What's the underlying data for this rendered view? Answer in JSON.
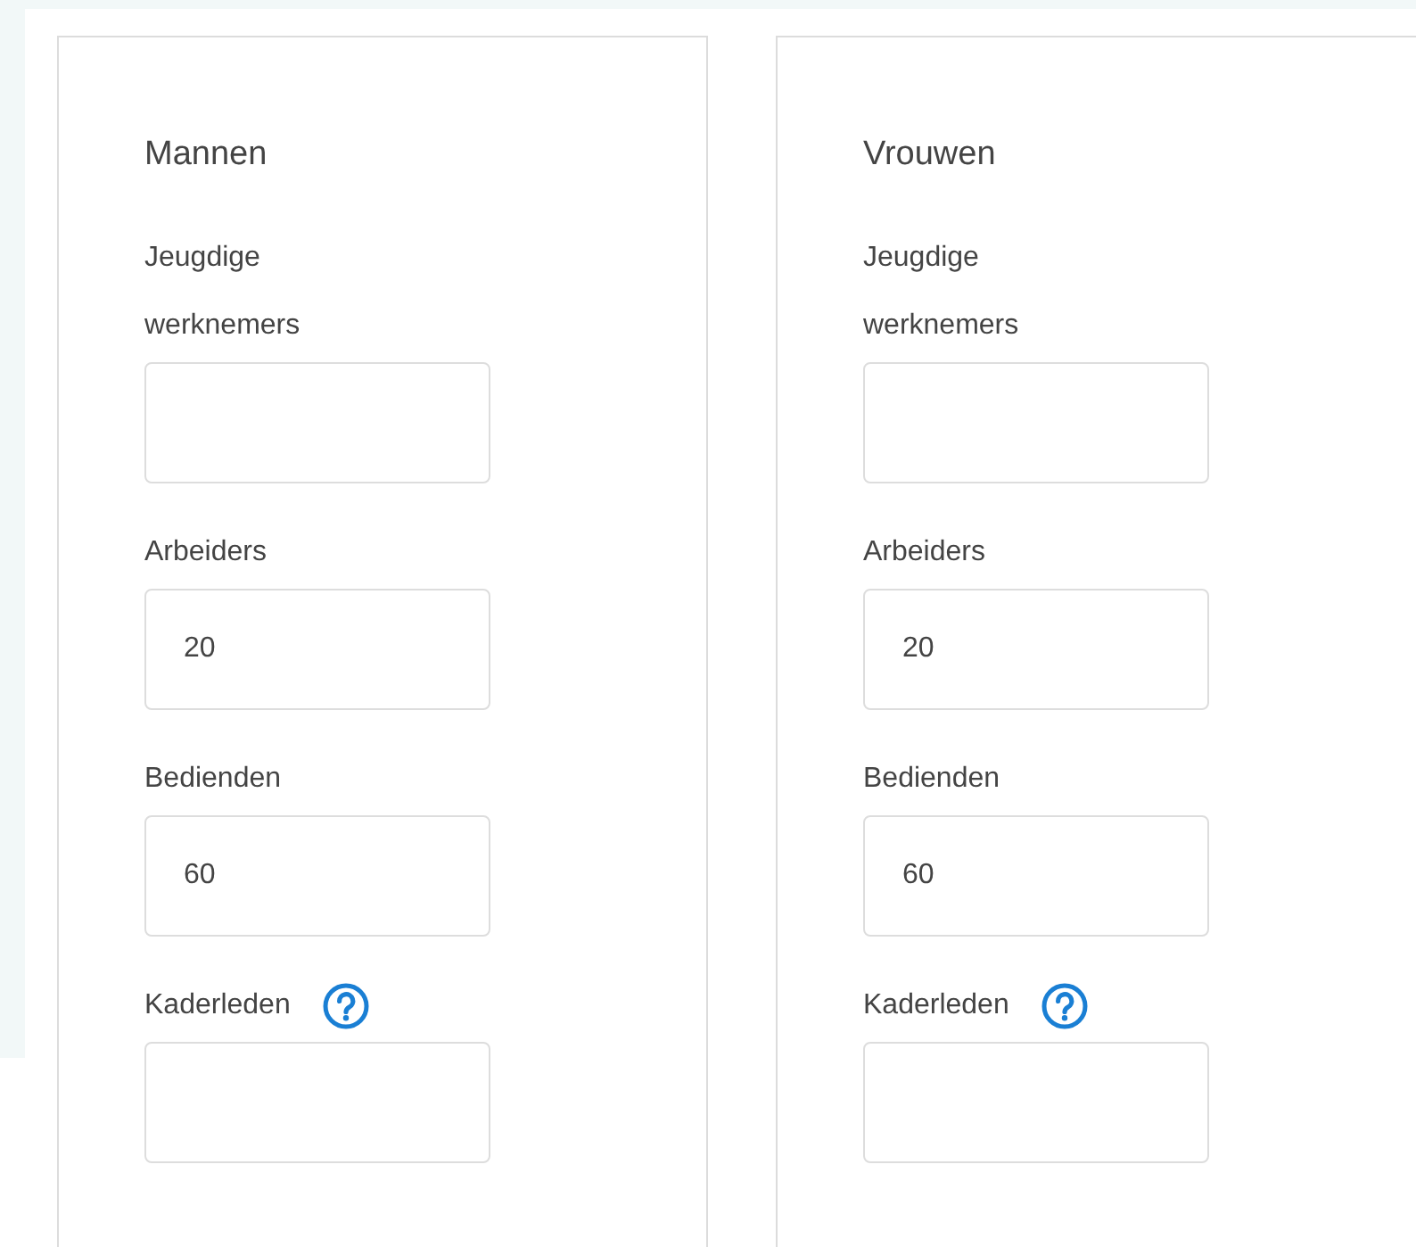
{
  "columns": [
    {
      "title": "Mannen",
      "fields": [
        {
          "label": "Jeugdige werknemers",
          "help": false
        },
        {
          "label": "Arbeiders",
          "value": "20",
          "help": false
        },
        {
          "label": "Bedienden",
          "value": "60",
          "help": false
        },
        {
          "label": "Kaderleden",
          "help": true
        }
      ]
    },
    {
      "title": "Vrouwen",
      "fields": [
        {
          "label": "Jeugdige werknemers",
          "help": false
        },
        {
          "label": "Arbeiders",
          "value": "20",
          "help": false
        },
        {
          "label": "Bedienden",
          "value": "60",
          "help": false
        },
        {
          "label": "Kaderleden",
          "help": true
        }
      ]
    }
  ]
}
